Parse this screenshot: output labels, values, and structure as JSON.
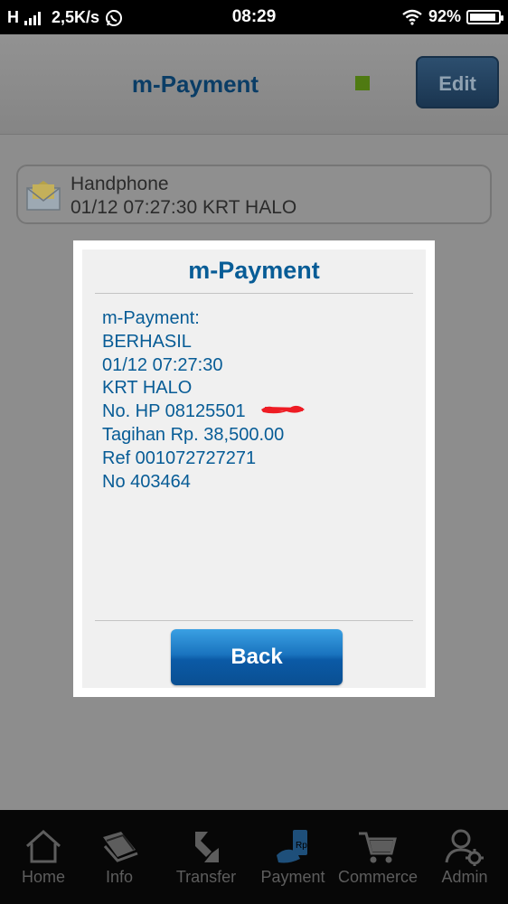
{
  "statusbar": {
    "network": "H",
    "speed": "2,5K/s",
    "time": "08:29",
    "battery_percent": "92%",
    "battery_level": 0.92
  },
  "header": {
    "title": "m-Payment",
    "edit_label": "Edit",
    "status_color": "#4f7a12"
  },
  "message": {
    "sender": "Handphone",
    "preview": "01/12 07:27:30 KRT HALO",
    "icon": "envelope-icon"
  },
  "dialog": {
    "title": "m-Payment",
    "lines": [
      "m-Payment:",
      "BERHASIL",
      "01/12 07:27:30",
      "KRT HALO",
      "No. HP 08125501",
      "Tagihan Rp. 38,500.00",
      "Ref 001072727271",
      "No 403464"
    ],
    "back_label": "Back",
    "text_color": "#075c96"
  },
  "nav": {
    "items": [
      {
        "label": "Home",
        "icon": "home-icon"
      },
      {
        "label": "Info",
        "icon": "info-book-icon"
      },
      {
        "label": "Transfer",
        "icon": "transfer-icon"
      },
      {
        "label": "Payment",
        "icon": "payment-icon"
      },
      {
        "label": "Commerce",
        "icon": "cart-icon"
      },
      {
        "label": "Admin",
        "icon": "admin-icon"
      }
    ]
  }
}
